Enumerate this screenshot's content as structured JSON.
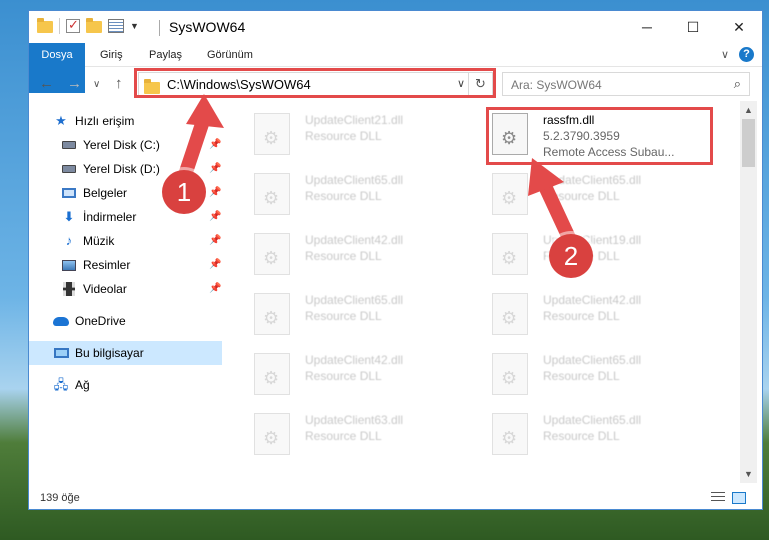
{
  "window": {
    "title": "SysWOW64",
    "controls": {
      "minimize": "─",
      "maximize": "☐",
      "close": "✕"
    }
  },
  "ribbon": {
    "tabs": [
      "Dosya",
      "Giriş",
      "Paylaş",
      "Görünüm"
    ],
    "help": "?"
  },
  "nav": {
    "back": "←",
    "forward": "→",
    "recent": "∨",
    "up": "↑",
    "address": "C:\\Windows\\SysWOW64",
    "refresh": "↻",
    "search_placeholder": "Ara: SysWOW64"
  },
  "sidebar": {
    "items": [
      {
        "label": "Hızlı erişim",
        "icon": "star-icon",
        "pinned": false
      },
      {
        "label": "Yerel Disk (C:)",
        "icon": "drive-icon",
        "pinned": true
      },
      {
        "label": "Yerel Disk (D:)",
        "icon": "drive-icon",
        "pinned": true
      },
      {
        "label": "Belgeler",
        "icon": "documents-icon",
        "pinned": true
      },
      {
        "label": "İndirmeler",
        "icon": "download-icon",
        "pinned": true
      },
      {
        "label": "Müzik",
        "icon": "music-icon",
        "pinned": true
      },
      {
        "label": "Resimler",
        "icon": "pictures-icon",
        "pinned": true
      },
      {
        "label": "Videolar",
        "icon": "videos-icon",
        "pinned": true
      },
      {
        "label": "OneDrive",
        "icon": "onedrive-icon",
        "pinned": false
      },
      {
        "label": "Bu bilgisayar",
        "icon": "computer-icon",
        "pinned": false,
        "selected": true
      },
      {
        "label": "Ağ",
        "icon": "network-icon",
        "pinned": false
      }
    ]
  },
  "files": {
    "left": [
      {
        "name": "UpdateClient21.dll",
        "desc": "Resource DLL"
      },
      {
        "name": "UpdateClient65.dll",
        "desc": "Resource DLL"
      },
      {
        "name": "UpdateClient42.dll",
        "desc": "Resource DLL"
      },
      {
        "name": "UpdateClient65.dll",
        "desc": "Resource DLL"
      },
      {
        "name": "UpdateClient42.dll",
        "desc": "Resource DLL"
      },
      {
        "name": "UpdateClient63.dll",
        "desc": "Resource DLL"
      }
    ],
    "selected": {
      "name": "rassfm.dll",
      "version": "5.2.3790.3959",
      "desc": "Remote Access Subau..."
    },
    "right": [
      {
        "name": "UpdateClient65.dll",
        "desc": "Resource DLL"
      },
      {
        "name": "UpdateClient19.dll",
        "desc": "Resource DLL"
      },
      {
        "name": "UpdateClient42.dll",
        "desc": "Resource DLL"
      },
      {
        "name": "UpdateClient65.dll",
        "desc": "Resource DLL"
      },
      {
        "name": "UpdateClient65.dll",
        "desc": "Resource DLL"
      }
    ]
  },
  "status": {
    "count": "139 öğe"
  },
  "annotations": {
    "step1": "1",
    "step2": "2",
    "color": "#e34a4a"
  }
}
